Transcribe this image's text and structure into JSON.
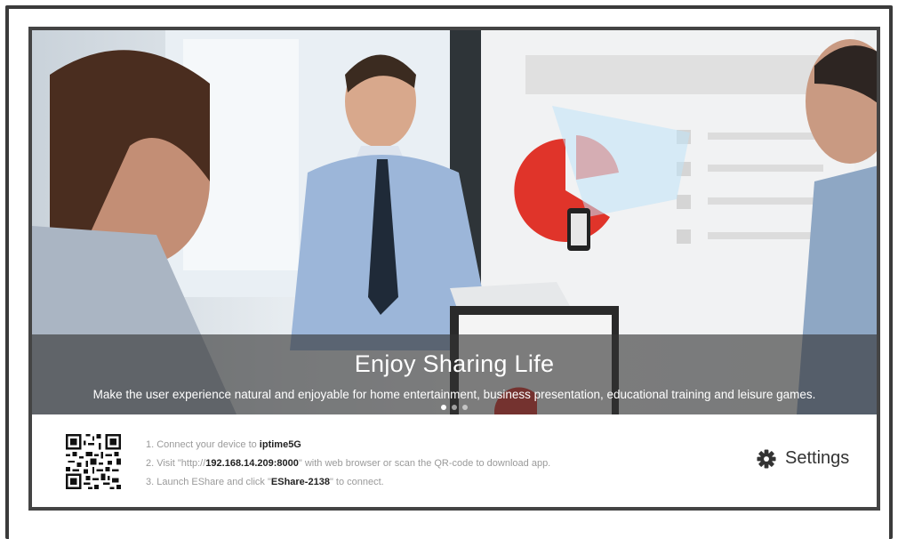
{
  "hero": {
    "title": "Enjoy Sharing Life",
    "subtitle": "Make the user experience natural and enjoyable for home entertainment, business presentation, educational training and leisure games.",
    "carousel_dots": 3,
    "active_dot": 1
  },
  "connect": {
    "step1_prefix": "1. Connect your device to ",
    "step1_network": "iptime5G",
    "step2_prefix": "2. Visit \"http://",
    "step2_address": "192.168.14.209:8000",
    "step2_suffix": "\" with web browser or scan the QR-code to download app.",
    "step3_prefix": "3. Launch EShare and click \"",
    "step3_device": "EShare-2138",
    "step3_suffix": "\" to connect."
  },
  "settings": {
    "label": "Settings",
    "icon": "gear-icon"
  },
  "colors": {
    "overlay": "#323232",
    "accent_red": "#e0342a",
    "frame": "#3b3b3b"
  }
}
